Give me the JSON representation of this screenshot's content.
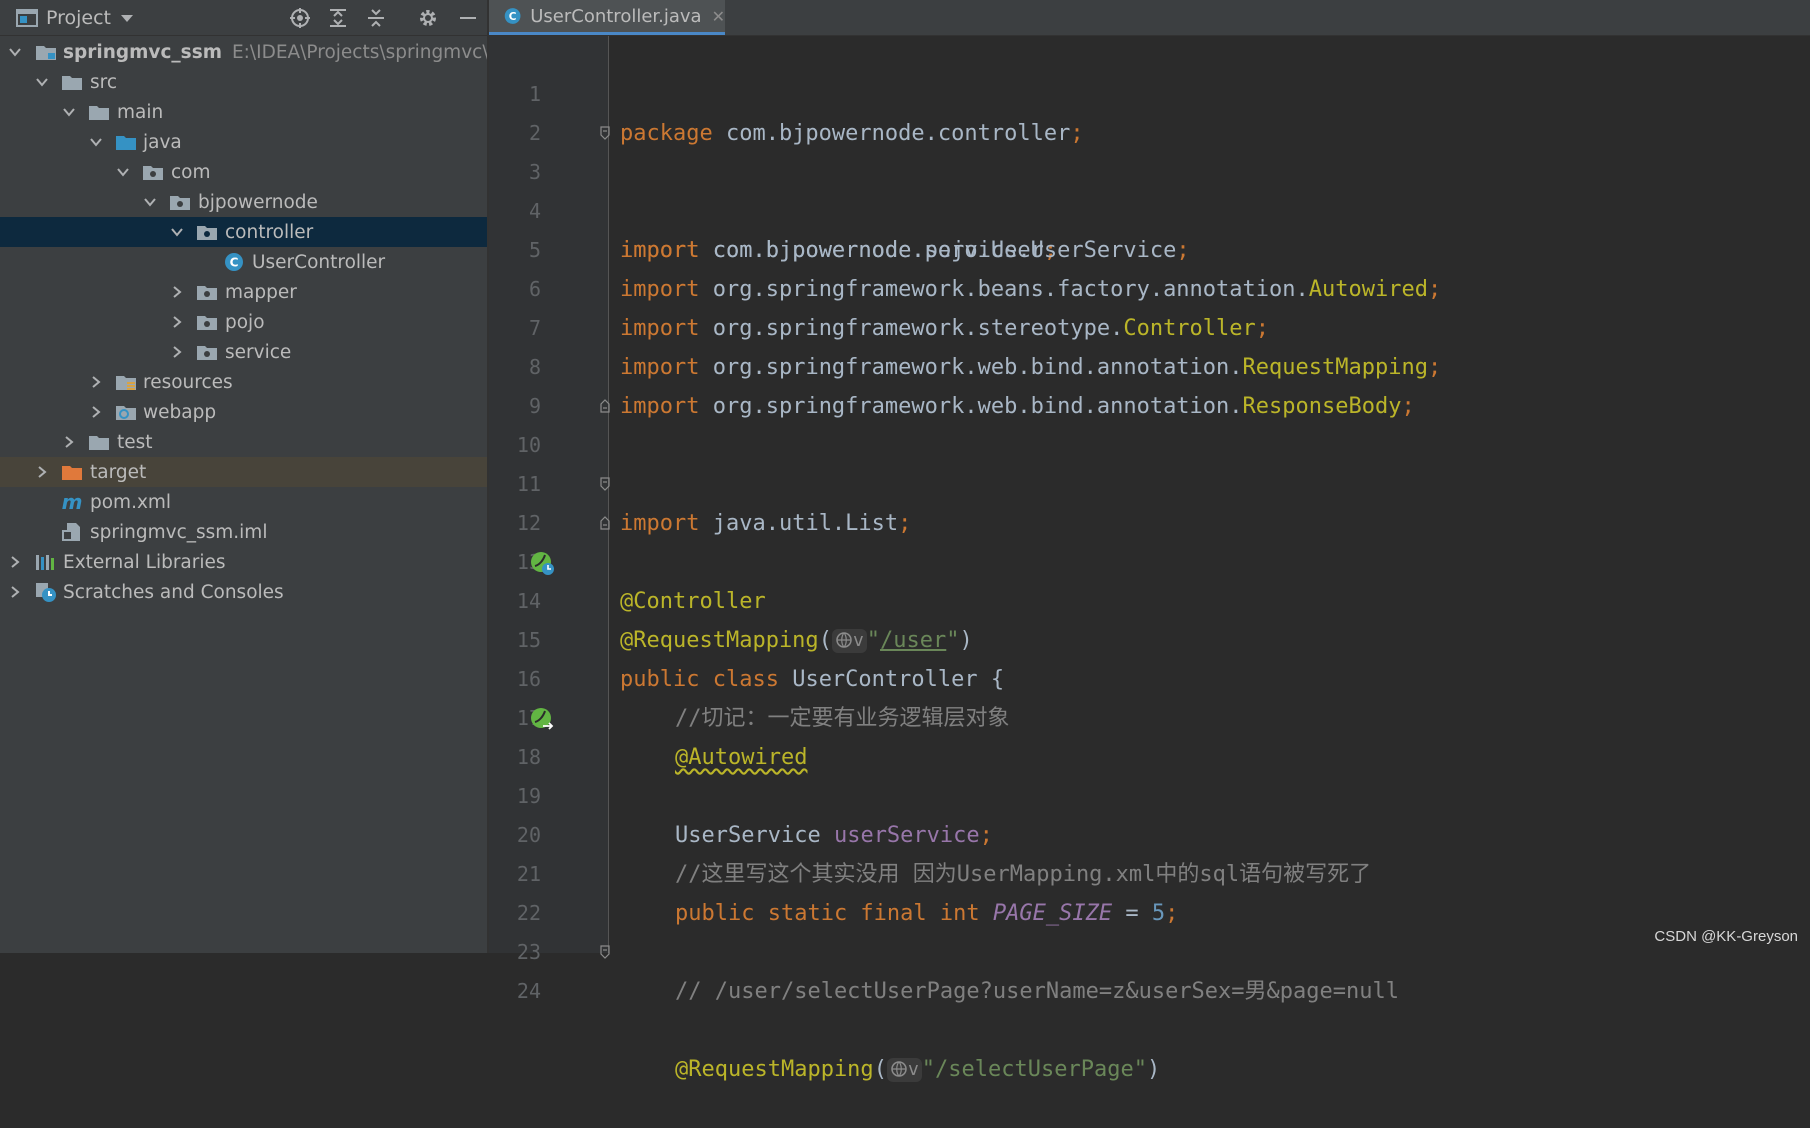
{
  "project_panel": {
    "title": "Project",
    "tree": [
      {
        "label": "springmvc_ssm",
        "path": "E:\\IDEA\\Projects\\springmvc\\spri",
        "icon": "module-folder-icon",
        "expanded": true
      },
      {
        "label": "src",
        "icon": "folder-icon",
        "expanded": true
      },
      {
        "label": "main",
        "icon": "folder-icon",
        "expanded": true
      },
      {
        "label": "java",
        "icon": "source-folder-icon",
        "expanded": true
      },
      {
        "label": "com",
        "icon": "package-icon",
        "expanded": true
      },
      {
        "label": "bjpowernode",
        "icon": "package-icon",
        "expanded": true
      },
      {
        "label": "controller",
        "icon": "package-icon",
        "expanded": true,
        "selected": true
      },
      {
        "label": "UserController",
        "icon": "java-class-icon"
      },
      {
        "label": "mapper",
        "icon": "package-icon",
        "expanded": false
      },
      {
        "label": "pojo",
        "icon": "package-icon",
        "expanded": false
      },
      {
        "label": "service",
        "icon": "package-icon",
        "expanded": false
      },
      {
        "label": "resources",
        "icon": "resources-folder-icon",
        "expanded": false
      },
      {
        "label": "webapp",
        "icon": "web-folder-icon",
        "expanded": false
      },
      {
        "label": "test",
        "icon": "folder-icon",
        "expanded": false
      },
      {
        "label": "target",
        "icon": "excluded-folder-icon",
        "expanded": false
      },
      {
        "label": "pom.xml",
        "icon": "maven-icon"
      },
      {
        "label": "springmvc_ssm.iml",
        "icon": "iml-file-icon"
      },
      {
        "label": "External Libraries",
        "icon": "libraries-icon",
        "expanded": false
      },
      {
        "label": "Scratches and Consoles",
        "icon": "scratches-icon",
        "expanded": false
      }
    ]
  },
  "editor": {
    "tab_label": "UserController.java",
    "line_numbers": [
      "1",
      "2",
      "3",
      "4",
      "5",
      "6",
      "7",
      "8",
      "9",
      "10",
      "11",
      "12",
      "13",
      "14",
      "15",
      "16",
      "17",
      "18",
      "19",
      "20",
      "21",
      "22",
      "23",
      "24"
    ],
    "lines": {
      "l1": [
        "package",
        " com.bjpowernode.controller",
        ";"
      ],
      "l3": [
        "import",
        " com.bjpowernode.pojo.User",
        ";"
      ],
      "l4": [
        "import",
        " com.bjpowernode.service.UserService",
        ";"
      ],
      "l5": [
        "import",
        " org.springframework.beans.factory.annotation.",
        "Autowired",
        ";"
      ],
      "l6": [
        "import",
        " org.springframework.stereotype.",
        "Controller",
        ";"
      ],
      "l7": [
        "import",
        " org.springframework.web.bind.annotation.",
        "RequestMapping",
        ";"
      ],
      "l8": [
        "import",
        " org.springframework.web.bind.annotation.",
        "ResponseBody",
        ";"
      ],
      "l10": [
        "import",
        " java.util.List",
        ";"
      ],
      "l12": [
        "@Controller"
      ],
      "l13": [
        "@RequestMapping",
        "(",
        "\"",
        "/user",
        "\"",
        ")"
      ],
      "l14": [
        "public class",
        " UserController {"
      ],
      "l16": [
        "//切记：一定要有业务逻辑层对象"
      ],
      "l17": [
        "@Autowired"
      ],
      "l18": [
        "UserService ",
        "userService",
        ";"
      ],
      "l20": [
        "//这里写这个其实没用 因为UserMapping.xml中的sql语句被写死了"
      ],
      "l21": [
        "public static final int",
        " ",
        "PAGE_SIZE",
        " = ",
        "5",
        ";"
      ],
      "l23": [
        "// /user/selectUserPage?userName=z&userSex=男&page=null"
      ],
      "l24": [
        "@RequestMapping",
        "(",
        "\"/selectUserPage\"",
        ")"
      ]
    },
    "hint_glyph": "v"
  },
  "watermark": "CSDN @KK-Greyson",
  "colors": {
    "keyword": "#cc7832",
    "annotation": "#bbb529",
    "string": "#6a8759",
    "field": "#9876aa",
    "number": "#6897bb",
    "comment": "#808080",
    "plain": "#a9b7c6",
    "selection": "#0d293e"
  }
}
